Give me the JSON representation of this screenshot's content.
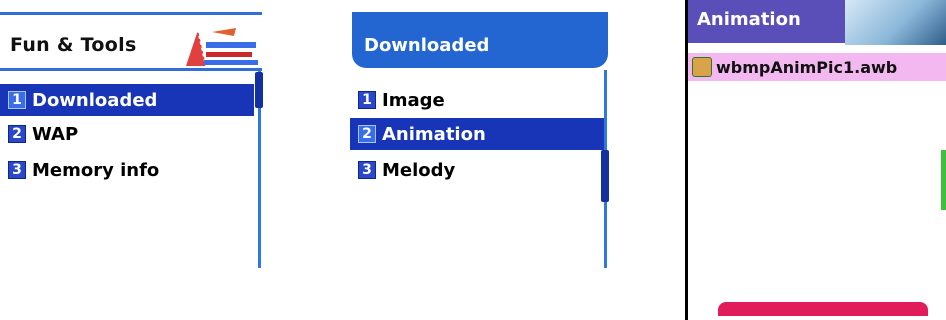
{
  "screen1": {
    "title": "Fun & Tools",
    "items": [
      {
        "num": "1",
        "label": "Downloaded",
        "selected": true
      },
      {
        "num": "2",
        "label": "WAP",
        "selected": false
      },
      {
        "num": "3",
        "label": "Memory info",
        "selected": false
      }
    ]
  },
  "screen2": {
    "title": "Downloaded",
    "items": [
      {
        "num": "1",
        "label": "Image",
        "selected": false
      },
      {
        "num": "2",
        "label": "Animation",
        "selected": true
      },
      {
        "num": "3",
        "label": "Melody",
        "selected": false
      }
    ]
  },
  "screen3": {
    "title": "Animation",
    "file_name": "wbmpAnimPic1.awb"
  },
  "colors": {
    "selection": "#1835b8",
    "header_blue": "#2366d1",
    "header_purple": "#5a4fb8",
    "file_highlight": "#f4b8f0"
  }
}
